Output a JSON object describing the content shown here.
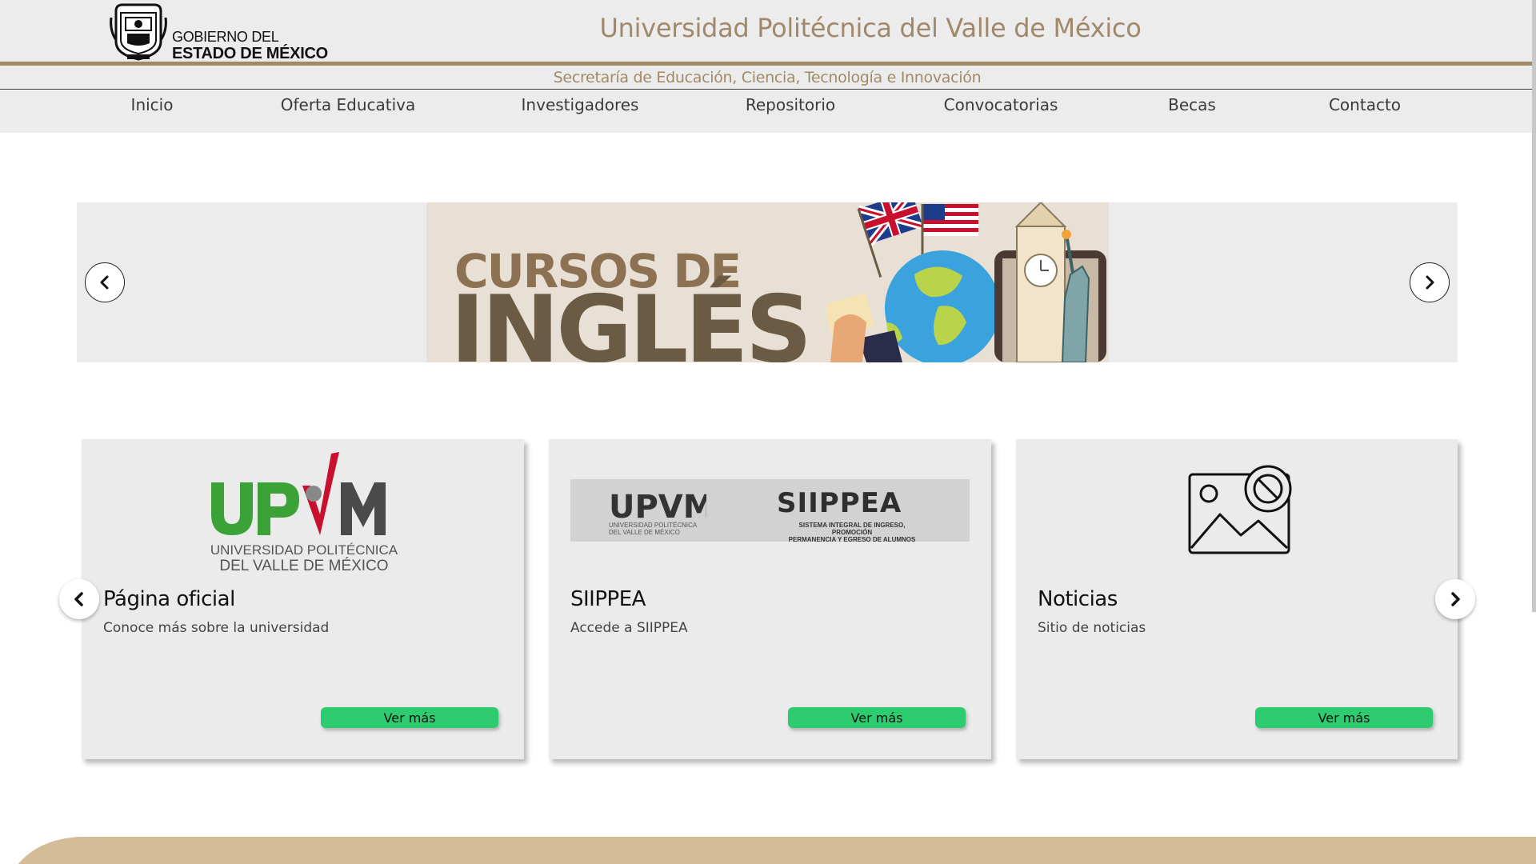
{
  "header": {
    "gov_line1": "GOBIERNO DEL",
    "gov_line2": "ESTADO DE MÉXICO",
    "gov_logo_icon": "coat-of-arms-icon",
    "title": "Universidad Politécnica del Valle de México",
    "subtitle": "Secretaría de Educación, Ciencia, Tecnología e Innovación",
    "accent_color": "#a08a66"
  },
  "nav": {
    "items": [
      {
        "label": "Inicio"
      },
      {
        "label": "Oferta Educativa"
      },
      {
        "label": "Investigadores"
      },
      {
        "label": "Repositorio"
      },
      {
        "label": "Convocatorias"
      },
      {
        "label": "Becas"
      },
      {
        "label": "Contacto"
      }
    ]
  },
  "banner": {
    "line1": "CURSOS DE",
    "line2": "INGLÉS",
    "prev_icon": "chevron-left-icon",
    "next_icon": "chevron-right-icon"
  },
  "cards": [
    {
      "logo_text_main": "UPVM",
      "logo_sub1": "UNIVERSIDAD POLITÉCNICA",
      "logo_sub2": "DEL VALLE DE MÉXICO",
      "title": "Página oficial",
      "desc": "Conoce más sobre la universidad",
      "button": "Ver más"
    },
    {
      "logo_left": "UPVM",
      "logo_left_sub1": "UNIVERSIDAD POLITÉCNICA",
      "logo_left_sub2": "DEL VALLE DE MÉXICO",
      "logo_right": "SIIPPEA",
      "logo_right_sub1": "SISTEMA INTEGRAL DE INGRESO, PROMOCIÓN",
      "logo_right_sub2": "PERMANENCIA Y EGRESO DE ALUMNOS",
      "title": "SIIPPEA",
      "desc": "Accede a SIIPPEA",
      "button": "Ver más"
    },
    {
      "image_icon": "image-unavailable-icon",
      "title": "Noticias",
      "desc": "Sitio de noticias",
      "button": "Ver más"
    }
  ],
  "colors": {
    "button_green": "#2ecc71",
    "title_color": "#a0896a",
    "footer_tan": "#d3bc97"
  }
}
